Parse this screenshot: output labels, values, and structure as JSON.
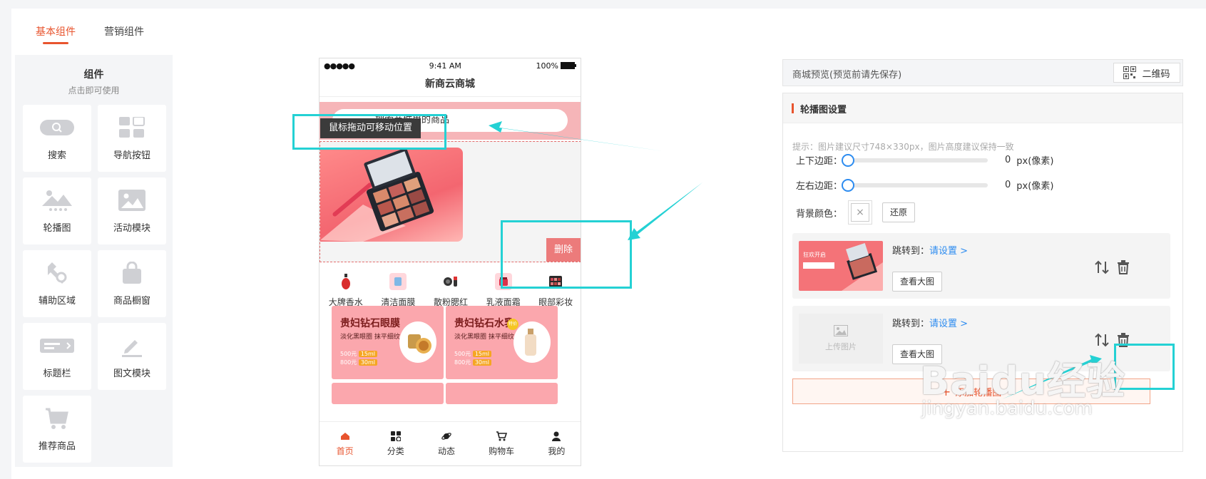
{
  "tabs": [
    {
      "label": "基本组件",
      "active": true
    },
    {
      "label": "营销组件",
      "active": false
    }
  ],
  "components_panel": {
    "title": "组件",
    "subtitle": "点击即可使用",
    "items": [
      {
        "label": "搜索",
        "icon": "search-icon"
      },
      {
        "label": "导航按钮",
        "icon": "nav-button-icon"
      },
      {
        "label": "轮播图",
        "icon": "carousel-icon"
      },
      {
        "label": "活动模块",
        "icon": "image-icon"
      },
      {
        "label": "辅助区域",
        "icon": "wrench-icon"
      },
      {
        "label": "商品橱窗",
        "icon": "shopping-bag-icon"
      },
      {
        "label": "标题栏",
        "icon": "title-bar-icon"
      },
      {
        "label": "图文模块",
        "icon": "pencil-icon"
      },
      {
        "label": "推荐商品",
        "icon": "cart-icon"
      }
    ]
  },
  "phone": {
    "status": {
      "signal": "●●●●●",
      "time": "9:41 AM",
      "battery": "100%"
    },
    "store_name": "新商云商城",
    "search_text": "搜索商城里的商品",
    "drag_tip": "鼠标拖动可移动位置",
    "delete_label": "删除",
    "categories": [
      {
        "label": "大牌香水"
      },
      {
        "label": "清洁面膜"
      },
      {
        "label": "散粉腮红"
      },
      {
        "label": "乳液面霜"
      },
      {
        "label": "眼部彩妆"
      }
    ],
    "promos": [
      {
        "title": "贵妇钻石眼膜",
        "subtitle": "淡化黑眼圈 抹平细纹",
        "price1": "500元",
        "tag1": "15ml",
        "price2": "800元",
        "tag2": "30ml"
      },
      {
        "title": "贵妇钻石水乳",
        "subtitle": "淡化黑眼圈 抹平细纹",
        "price1": "500元",
        "tag1": "15ml",
        "price2": "800元",
        "tag2": "30ml",
        "badge": "特价"
      }
    ],
    "tabbar": [
      {
        "label": "首页",
        "active": true
      },
      {
        "label": "分类",
        "active": false
      },
      {
        "label": "动态",
        "active": false
      },
      {
        "label": "购物车",
        "active": false
      },
      {
        "label": "我的",
        "active": false
      }
    ]
  },
  "preview": {
    "text": "商城预览(预览前请先保存)",
    "qr_label": "二维码"
  },
  "settings": {
    "title": "轮播图设置",
    "hint": "提示：图片建议尺寸748×330px，图片高度建议保持一致",
    "vertical_margin": {
      "label": "上下边距：",
      "value": "0",
      "unit": "px(像素)",
      "level": 0
    },
    "horizontal_margin": {
      "label": "左右边距：",
      "value": "0",
      "unit": "px(像素)",
      "level": 0
    },
    "bg_color": {
      "label": "背景颜色：",
      "reset_label": "还原"
    },
    "items": [
      {
        "jump_label": "跳转到：",
        "jump_link": "请设置 >",
        "view_label": "查看大图",
        "has_image": true,
        "thumb_text": "狂欢开启"
      },
      {
        "jump_label": "跳转到：",
        "jump_link": "请设置 >",
        "view_label": "查看大图",
        "has_image": false,
        "upload_label": "上传图片"
      }
    ],
    "add_label": "添加轮播图"
  },
  "watermark": {
    "text": "Baidu经验",
    "url": "jingyan.baidu.com"
  },
  "colors": {
    "accent": "#e8542e",
    "link": "#2d8cf0",
    "annotation": "#24d1d4",
    "promo_bg": "#fba7ad"
  }
}
